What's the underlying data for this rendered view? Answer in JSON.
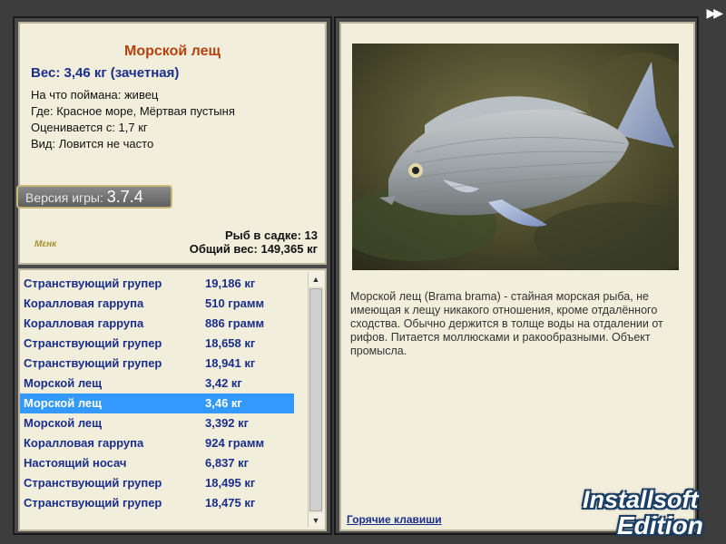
{
  "fish": {
    "title": "Морской лещ",
    "weight_line": "Вес: 3,46 кг (зачетная)",
    "caught_on": "На что поймана: живец",
    "location": "Где: Красное море, Мёртвая пустыня",
    "valued_from": "Оценивается с: 1,7 кг",
    "rarity": "Вид: Ловится не часто"
  },
  "version": {
    "label": "Версия игры:",
    "number": "3.7.4"
  },
  "small_logo": "Mεнк",
  "keepnet": {
    "count": "Рыб в садке: 13",
    "total_weight": "Общий вес: 149,365 кг"
  },
  "catch_list": [
    {
      "name": "Странствующий групер",
      "weight": "19,186 кг"
    },
    {
      "name": "Коралловая гаррупа",
      "weight": "510 грамм"
    },
    {
      "name": "Коралловая гаррупа",
      "weight": "886 грамм"
    },
    {
      "name": "Странствующий групер",
      "weight": "18,658 кг"
    },
    {
      "name": "Странствующий групер",
      "weight": "18,941 кг"
    },
    {
      "name": "Морской лещ",
      "weight": "3,42 кг"
    },
    {
      "name": "Морской лещ",
      "weight": "3,46 кг",
      "selected": true
    },
    {
      "name": "Морской лещ",
      "weight": "3,392 кг"
    },
    {
      "name": "Коралловая гаррупа",
      "weight": "924 грамм"
    },
    {
      "name": "Настоящий носач",
      "weight": "6,837 кг"
    },
    {
      "name": "Странствующий групер",
      "weight": "18,495 кг"
    },
    {
      "name": "Странствующий групер",
      "weight": "18,475 кг"
    }
  ],
  "description": "Морской лещ (Brama brama) - стайная морская рыба, не имеющая к лещу никакого отношения, кроме отдалённого сходства. Обычно держится в толще воды на отдалении от рифов. Питается моллюсками и ракообразными. Объект промысла.",
  "hotkeys_link": "Горячие клавиши",
  "watermark": {
    "line1": "Installsoft",
    "line2": "Edition"
  },
  "icons": {
    "forward": "fast-forward-icon",
    "scroll_up": "chevron-up-icon",
    "scroll_down": "chevron-down-icon"
  }
}
